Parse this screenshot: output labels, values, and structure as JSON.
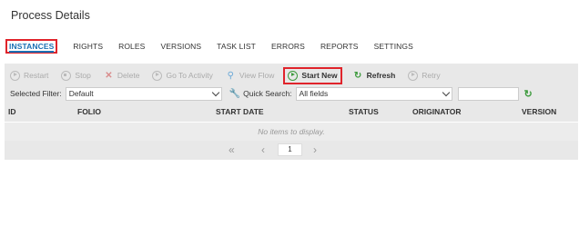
{
  "page": {
    "title": "Process Details"
  },
  "tabs": [
    {
      "label": "INSTANCES",
      "active": true
    },
    {
      "label": "RIGHTS"
    },
    {
      "label": "ROLES"
    },
    {
      "label": "VERSIONS"
    },
    {
      "label": "TASK LIST"
    },
    {
      "label": "ERRORS"
    },
    {
      "label": "REPORTS"
    },
    {
      "label": "SETTINGS"
    }
  ],
  "toolbar": {
    "restart": "Restart",
    "stop": "Stop",
    "delete": "Delete",
    "go_to_activity": "Go To Activity",
    "view_flow": "View Flow",
    "start_new": "Start New",
    "refresh": "Refresh",
    "retry": "Retry"
  },
  "filter": {
    "selected_label": "Selected Filter:",
    "selected_value": "Default",
    "quick_search_label": "Quick Search:",
    "quick_search_value": "All fields",
    "search_text": ""
  },
  "grid": {
    "columns": [
      "ID",
      "FOLIO",
      "START DATE",
      "STATUS",
      "ORIGINATOR",
      "VERSION"
    ],
    "empty_message": "No items to display."
  },
  "pager": {
    "page": "1"
  },
  "colors": {
    "accent": "#1a6fb3",
    "highlight": "#e0242b",
    "green": "#3e9b3e"
  },
  "icons": [
    "restart-icon",
    "stop-icon",
    "delete-icon",
    "go-to-activity-icon",
    "view-flow-icon",
    "start-new-icon",
    "refresh-icon",
    "retry-icon",
    "wrench-icon",
    "chevron-down-icon"
  ]
}
